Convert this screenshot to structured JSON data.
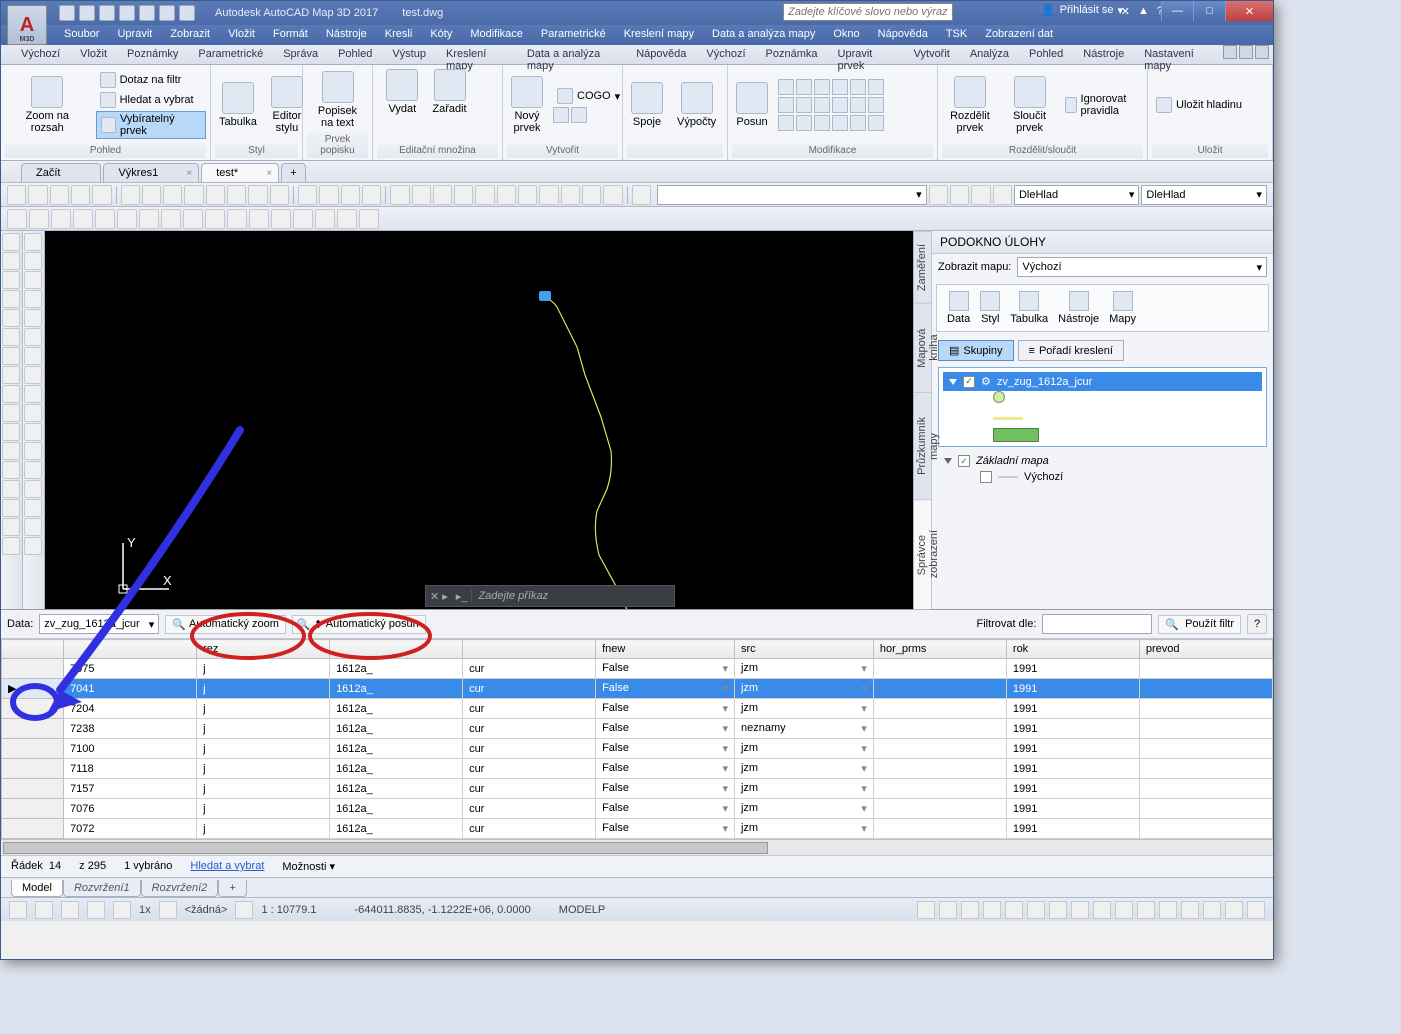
{
  "window": {
    "app_title": "Autodesk AutoCAD Map 3D 2017",
    "doc_title": "test.dwg",
    "search_placeholder": "Zadejte klíčové slovo nebo výraz.",
    "signin": "Přihlásit se"
  },
  "menu": [
    "Soubor",
    "Upravit",
    "Zobrazit",
    "Vložit",
    "Formát",
    "Nástroje",
    "Kresli",
    "Kóty",
    "Modifikace",
    "Parametrické",
    "Kreslení mapy",
    "Data a analýza mapy",
    "Okno",
    "Nápověda",
    "TSK",
    "Zobrazení dat"
  ],
  "tabs": [
    "Výchozí",
    "Vložit",
    "Poznámky",
    "Parametrické",
    "Správa",
    "Pohled",
    "Výstup",
    "Kreslení mapy",
    "Data a analýza mapy",
    "Nápověda",
    "Výchozí",
    "Poznámka",
    "Upravit prvek",
    "Vytvořit",
    "Analýza",
    "Pohled",
    "Nástroje",
    "Nastavení mapy"
  ],
  "ribbon": {
    "p1": {
      "btn": "Zoom na rozsah",
      "s1": "Dotaz na filtr",
      "s2": "Hledat a vybrat",
      "s3": "Vybíratelný prvek",
      "label": "Pohled"
    },
    "p2": {
      "b1": "Tabulka",
      "b2": "Editor\nstylu",
      "label": "Styl"
    },
    "p3": {
      "b1": "Popisek\nna text",
      "label": "Prvek popisku"
    },
    "p4": {
      "b1": "Vydat",
      "b2": "Zařadit",
      "label": "Editační množina"
    },
    "p5": {
      "b1": "Nový\nprvek",
      "cogo": "COGO",
      "label": "Vytvořit"
    },
    "p6": {
      "b1": "Spoje",
      "b2": "Výpočty",
      "label": ""
    },
    "p7": {
      "b1": "Posun",
      "label": "Modifikace"
    },
    "p8": {
      "b1": "Rozdělit\nprvek",
      "b2": "Sloučit\nprvek",
      "ign": "Ignorovat pravidla",
      "label": "Rozdělit/sloučit"
    },
    "p9": {
      "b1": "Uložit hladinu",
      "label": "Uložit"
    }
  },
  "filetabs": [
    {
      "label": "Začít",
      "closable": false
    },
    {
      "label": "Výkres1",
      "closable": true
    },
    {
      "label": "test*",
      "closable": true,
      "active": true
    }
  ],
  "layer_combo1": "DleHlad",
  "layer_combo2": "DleHlad",
  "command_placeholder": "Zadejte příkaz",
  "taskpane": {
    "title": "PODOKNO ÚLOHY",
    "vtabs": [
      "Zaměření",
      "Mapová kniha",
      "Průzkumník mapy",
      "Správce zobrazení"
    ],
    "map_label": "Zobrazit mapu:",
    "map_value": "Výchozí",
    "tools": [
      "Data",
      "Styl",
      "Tabulka",
      "Nástroje",
      "Mapy"
    ],
    "tab1": "Skupiny",
    "tab2": "Pořadí kreslení",
    "layer1": "zv_zug_1612a_jcur",
    "layer2": "Základní mapa",
    "layer3": "Výchozí"
  },
  "grid": {
    "label": "Data:",
    "source": "zv_zug_1612a_jcur",
    "auto_zoom": "Automatický zoom",
    "auto_pan": "Automatický posun",
    "filter_label": "Filtrovat dle:",
    "apply_filter": "Použít filtr",
    "columns": [
      "",
      "",
      "rez",
      "",
      "",
      "fnew",
      "src",
      "hor_prms",
      "rok",
      "prevod"
    ],
    "rows": [
      {
        "id": "7075",
        "rez": "j",
        "c3": "1612a_",
        "c4": "cur",
        "fnew": "False",
        "src": "jzm",
        "hor": "<Null>",
        "rok": "1991",
        "prev": "<Null>"
      },
      {
        "id": "7041",
        "rez": "j",
        "c3": "1612a_",
        "c4": "cur",
        "fnew": "False",
        "src": "jzm",
        "hor": "<Null>",
        "rok": "1991",
        "prev": "<Null>",
        "sel": true
      },
      {
        "id": "7204",
        "rez": "j",
        "c3": "1612a_",
        "c4": "cur",
        "fnew": "False",
        "src": "jzm",
        "hor": "<Null>",
        "rok": "1991",
        "prev": "<Null>"
      },
      {
        "id": "7238",
        "rez": "j",
        "c3": "1612a_",
        "c4": "cur",
        "fnew": "False",
        "src": "neznamy",
        "hor": "<Null>",
        "rok": "1991",
        "prev": "<Null>"
      },
      {
        "id": "7100",
        "rez": "j",
        "c3": "1612a_",
        "c4": "cur",
        "fnew": "False",
        "src": "jzm",
        "hor": "<Null>",
        "rok": "1991",
        "prev": "<Null>"
      },
      {
        "id": "7118",
        "rez": "j",
        "c3": "1612a_",
        "c4": "cur",
        "fnew": "False",
        "src": "jzm",
        "hor": "<Null>",
        "rok": "1991",
        "prev": "<Null>"
      },
      {
        "id": "7157",
        "rez": "j",
        "c3": "1612a_",
        "c4": "cur",
        "fnew": "False",
        "src": "jzm",
        "hor": "<Null>",
        "rok": "1991",
        "prev": "<Null>"
      },
      {
        "id": "7076",
        "rez": "j",
        "c3": "1612a_",
        "c4": "cur",
        "fnew": "False",
        "src": "jzm",
        "hor": "<Null>",
        "rok": "1991",
        "prev": "<Null>"
      },
      {
        "id": "7072",
        "rez": "j",
        "c3": "1612a_",
        "c4": "cur",
        "fnew": "False",
        "src": "jzm",
        "hor": "<Null>",
        "rok": "1991",
        "prev": "<Null>"
      }
    ],
    "status": {
      "row_lbl": "Řádek",
      "row": "14",
      "total": "z 295",
      "sel": "1 vybráno",
      "search": "Hledat a vybrat",
      "opts": "Možnosti"
    }
  },
  "modeltabs": [
    "Model",
    "Rozvržení1",
    "Rozvržení2"
  ],
  "statusbar": {
    "scale_pre": "1x",
    "scale_ann": "<žádná>",
    "scale": "1 : 10779.1",
    "coords": "-644011.8835, -1.1222E+06, 0.0000",
    "space": "MODELP"
  }
}
